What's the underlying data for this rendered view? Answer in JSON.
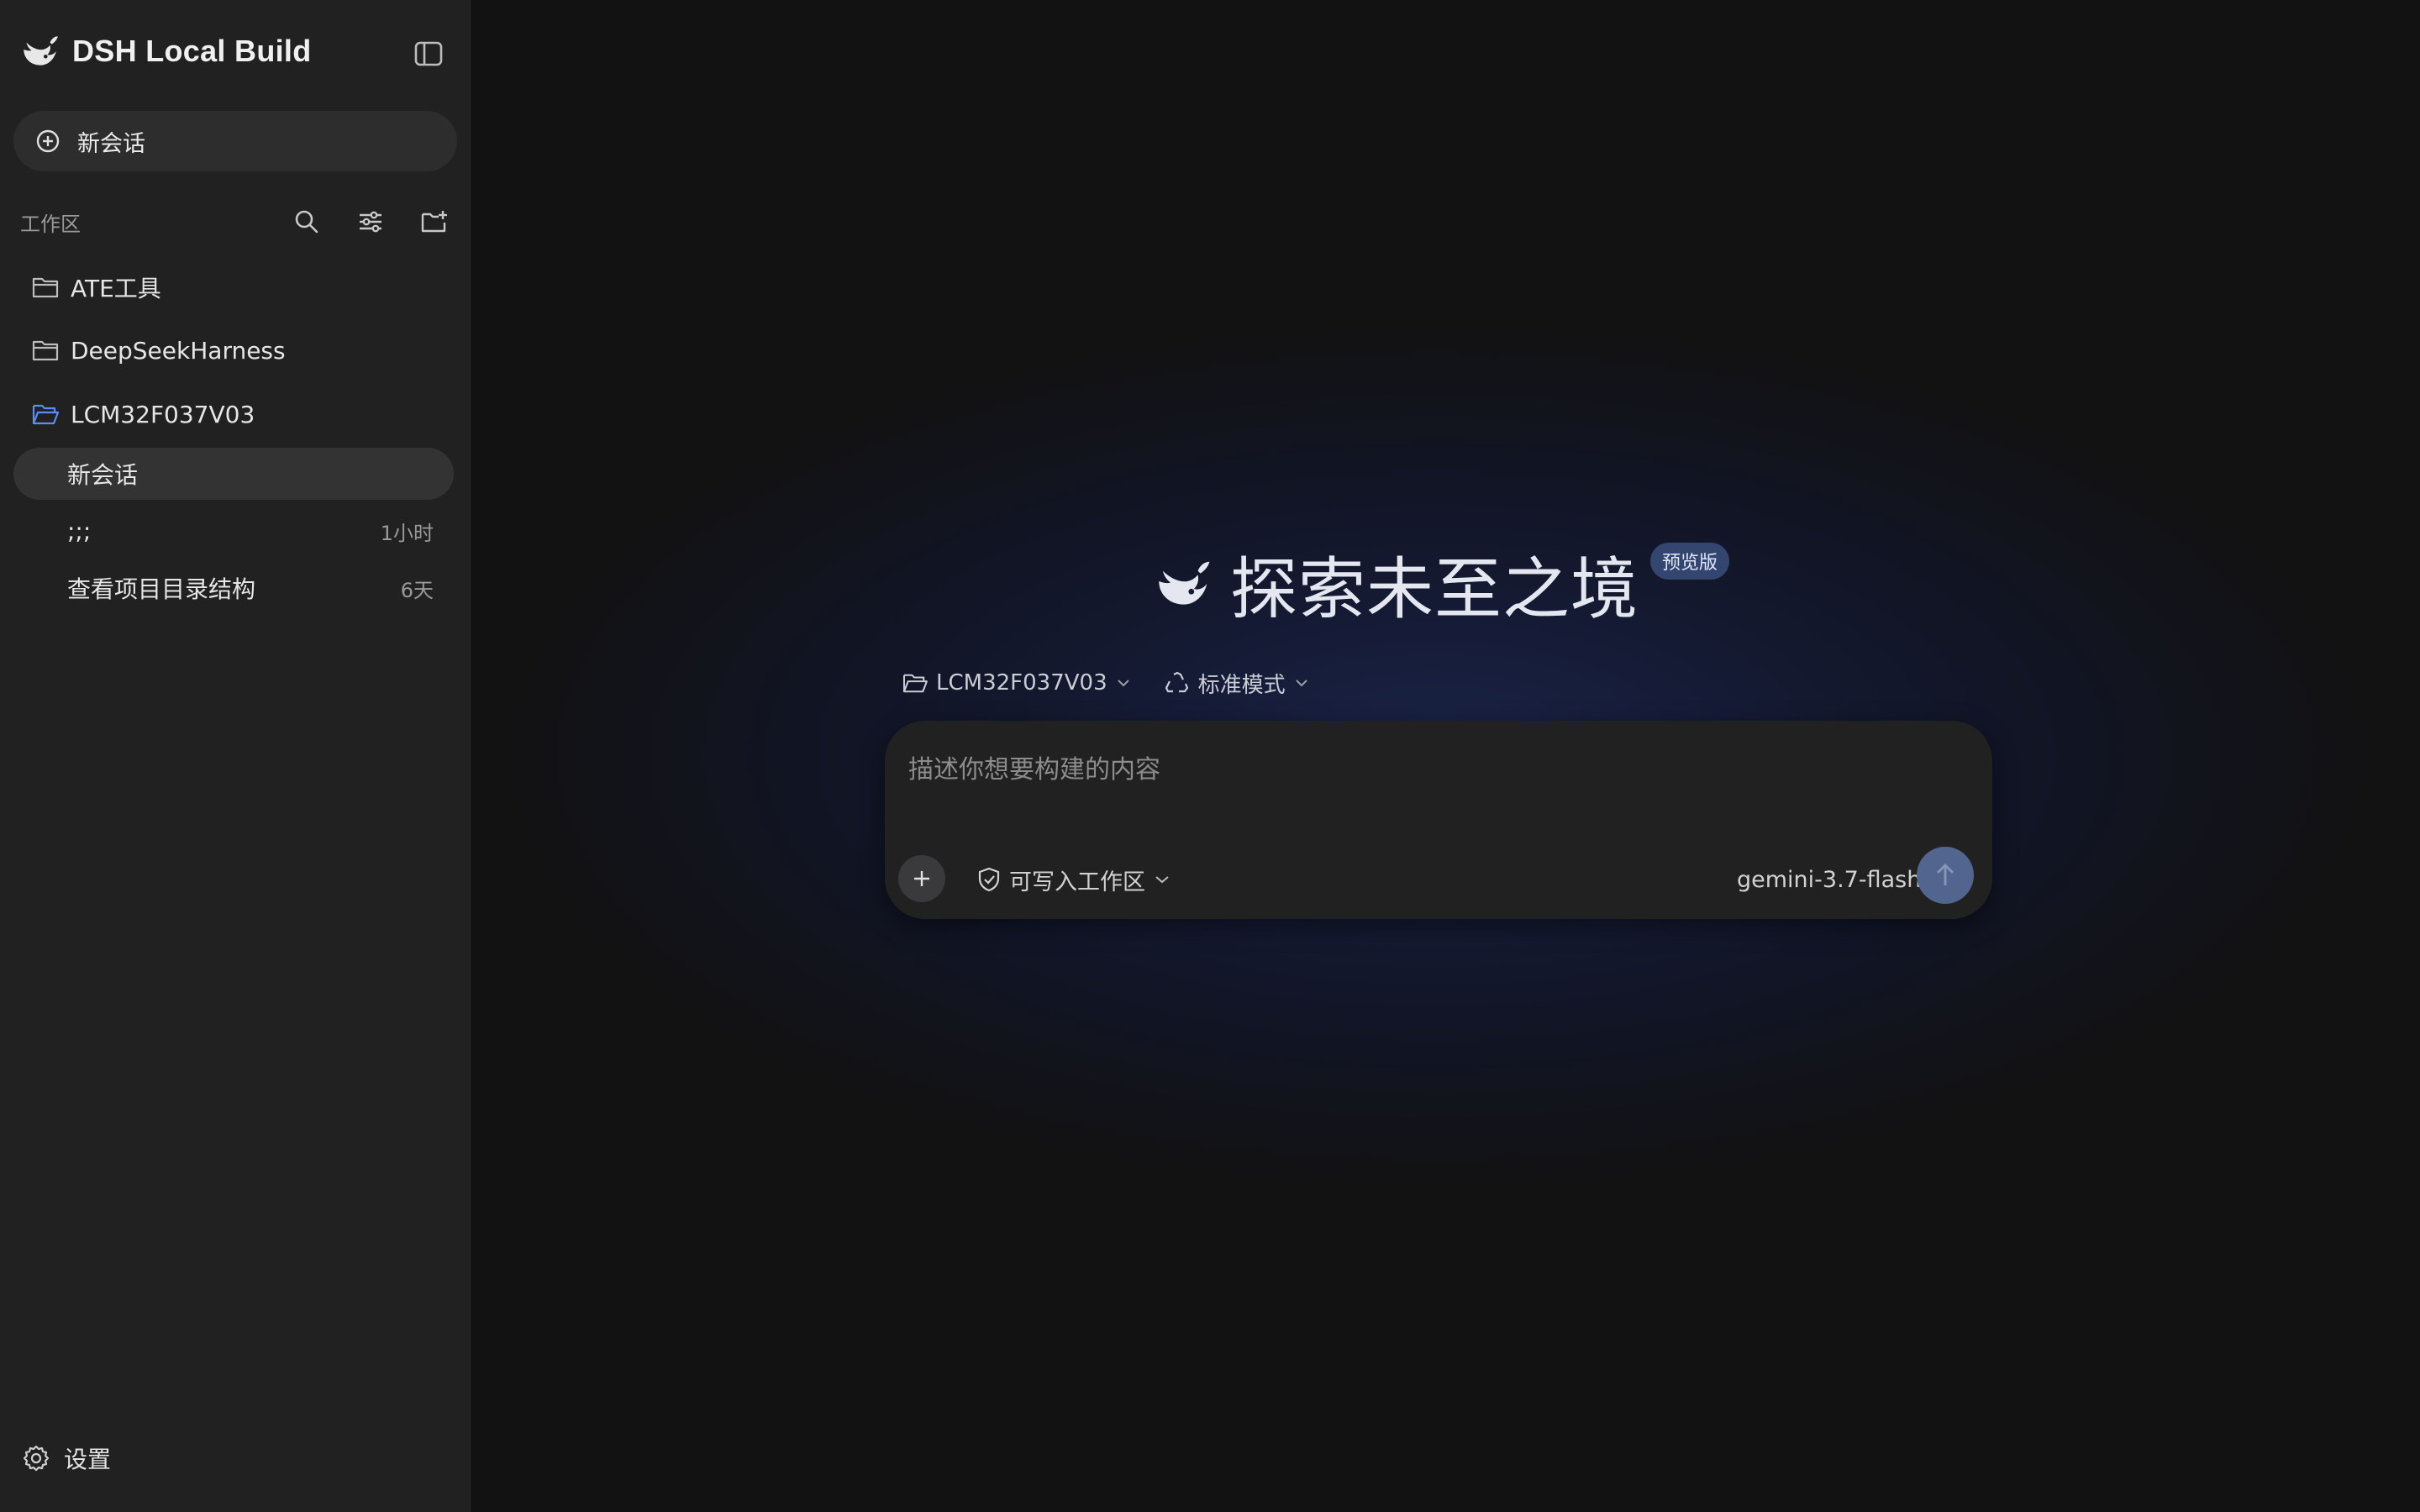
{
  "app": {
    "title": "DSH Local Build"
  },
  "sidebar": {
    "new_chat_label": "新会话",
    "workspace_label": "工作区",
    "folders": [
      {
        "name": "ATE工具",
        "open": false
      },
      {
        "name": "DeepSeekHarness",
        "open": false
      },
      {
        "name": "LCM32F037V03",
        "open": true
      }
    ],
    "sessions": [
      {
        "title": "新会话",
        "time": "",
        "active": true
      },
      {
        "title": ";;;",
        "time": "1小时",
        "active": false
      },
      {
        "title": "查看项目目录结构",
        "time": "6天",
        "active": false
      }
    ],
    "settings_label": "设置"
  },
  "main": {
    "hero_title": "探索未至之境",
    "preview_badge": "预览版",
    "workspace_chip": "LCM32F037V03",
    "mode_chip": "标准模式",
    "composer": {
      "placeholder": "描述你想要构建的内容",
      "value": "",
      "permission_label": "可写入工作区",
      "model_label": "gemini-3.7-flash"
    }
  },
  "colors": {
    "sidebar_bg": "#212121",
    "main_bg": "#121212",
    "accent_folder": "#5b8def",
    "send_button": "#52658f",
    "badge_bg": "#34466f"
  },
  "icons": {
    "brand": "whale-logo-icon",
    "collapse": "sidebar-toggle-icon",
    "new_chat": "plus-circle-icon",
    "search": "search-icon",
    "filter": "sliders-icon",
    "new_folder": "folder-plus-icon",
    "folder": "folder-icon",
    "folder_open": "folder-open-icon",
    "settings": "gear-icon",
    "mode": "recycle-icon",
    "permission": "shield-check-icon",
    "attach": "plus-icon",
    "send": "arrow-up-icon",
    "dropdown": "chevron-down-icon"
  }
}
